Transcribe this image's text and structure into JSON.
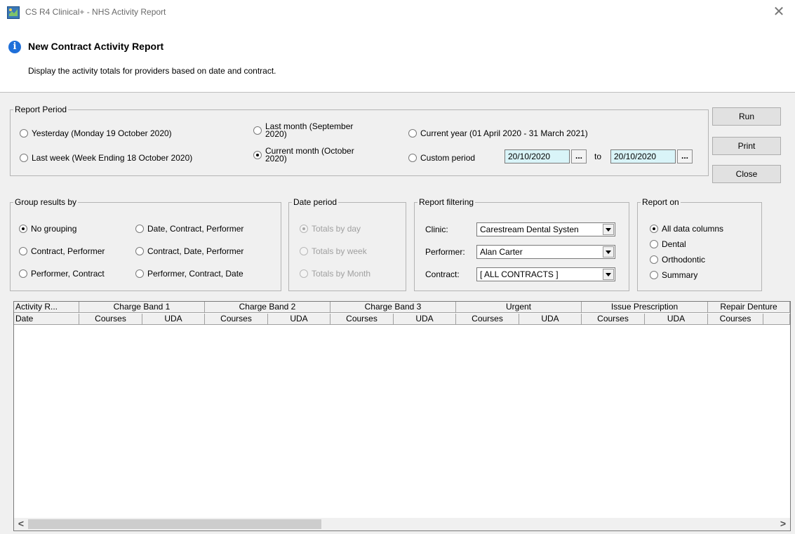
{
  "window": {
    "title": "CS R4 Clinical+ - NHS Activity Report",
    "close_glyph": "✕"
  },
  "header": {
    "title": "New Contract Activity Report",
    "subtitle": "Display the activity totals for providers based on date and contract."
  },
  "report_period": {
    "legend": "Report Period",
    "yesterday": "Yesterday (Monday 19 October 2020)",
    "last_week": "Last week (Week Ending 18 October 2020)",
    "last_month_l1": "Last month (September",
    "last_month_l2": "2020)",
    "current_month_l1": "Current month (October",
    "current_month_l2": "2020)",
    "current_year": "Current year (01 April 2020 - 31 March 2021)",
    "custom_period": "Custom period",
    "from_date": "20/10/2020",
    "to_label": "to",
    "to_date": "20/10/2020",
    "picker_label": "...",
    "selected": "current_month"
  },
  "buttons": {
    "run": "Run",
    "print": "Print",
    "close": "Close"
  },
  "group_by": {
    "legend": "Group results by",
    "options": [
      "No grouping",
      "Date, Contract, Performer",
      "Contract, Performer",
      "Contract, Date, Performer",
      "Performer, Contract",
      "Performer, Contract, Date"
    ],
    "selected": 0
  },
  "date_period": {
    "legend": "Date period",
    "options": [
      "Totals by day",
      "Totals by week",
      "Totals by Month"
    ],
    "selected": 0
  },
  "filtering": {
    "legend": "Report filtering",
    "clinic_label": "Clinic:",
    "clinic_value": "Carestream Dental Systen",
    "performer_label": "Performer:",
    "performer_value": "Alan Carter",
    "contract_label": "Contract:",
    "contract_value": "[ ALL CONTRACTS ]"
  },
  "report_on": {
    "legend": "Report on",
    "options": [
      "All data columns",
      "Dental",
      "Orthodontic",
      "Summary"
    ],
    "selected": 0
  },
  "grid": {
    "group_headers": [
      "Activity R...",
      "Charge Band 1",
      "Charge Band 2",
      "Charge Band 3",
      "Urgent",
      "Issue Prescription",
      "Repair Denture"
    ],
    "column_headers": [
      "Date",
      "Courses",
      "UDA",
      "Courses",
      "UDA",
      "Courses",
      "UDA",
      "Courses",
      "UDA",
      "Courses",
      "UDA",
      "Courses",
      ""
    ],
    "scroll_left": "<",
    "scroll_right": ">"
  },
  "colors": {
    "accent_info": "#1e6fd9",
    "date_field_bg": "#d9f4f8",
    "dialog_bg": "#f0f0f0"
  }
}
